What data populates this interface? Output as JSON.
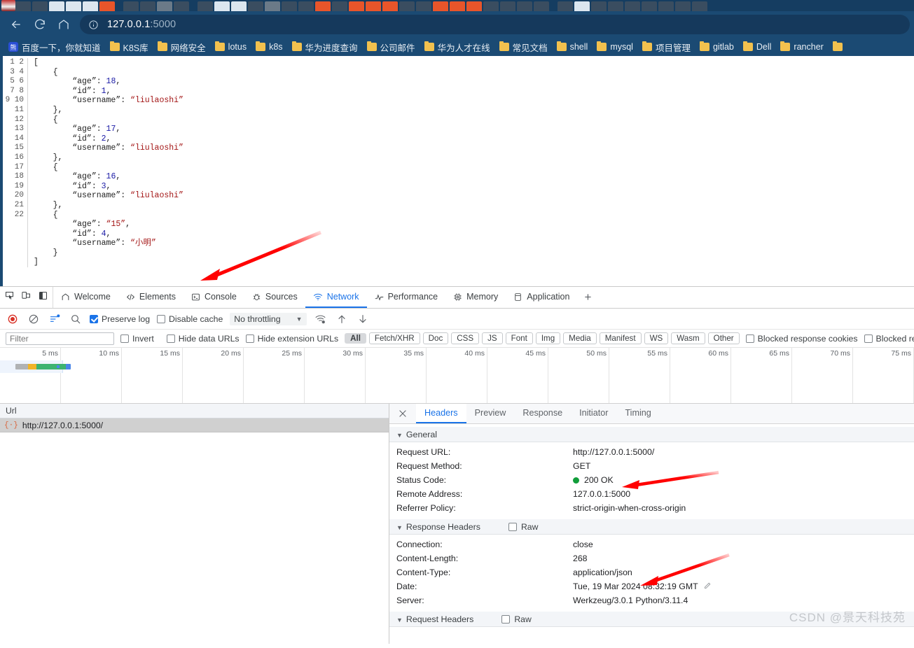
{
  "browser": {
    "nav": {
      "back": "back-arrow",
      "reload": "reload",
      "home": "home"
    },
    "omnibox": {
      "host": "127.0.0.1",
      "port": ":5000",
      "info_icon": "info-circle-icon"
    },
    "bookmarks": [
      {
        "label": "百度一下，你就知道",
        "icon": "baidu-icon"
      },
      {
        "label": "K8S库",
        "icon": "folder-icon"
      },
      {
        "label": "网络安全",
        "icon": "folder-icon"
      },
      {
        "label": "lotus",
        "icon": "folder-icon"
      },
      {
        "label": "k8s",
        "icon": "folder-icon"
      },
      {
        "label": "华为进度查询",
        "icon": "folder-icon"
      },
      {
        "label": "公司邮件",
        "icon": "folder-icon"
      },
      {
        "label": "华为人才在线",
        "icon": "folder-icon"
      },
      {
        "label": "常见文档",
        "icon": "folder-icon"
      },
      {
        "label": "shell",
        "icon": "folder-icon"
      },
      {
        "label": "mysql",
        "icon": "folder-icon"
      },
      {
        "label": "项目管理",
        "icon": "folder-icon"
      },
      {
        "label": "gitlab",
        "icon": "folder-icon"
      },
      {
        "label": "Dell",
        "icon": "folder-icon"
      },
      {
        "label": "rancher",
        "icon": "folder-icon"
      },
      {
        "label": "",
        "icon": "folder-icon"
      }
    ]
  },
  "page": {
    "json_lines": [
      "[",
      "    {",
      "        \"age\": 18,",
      "        \"id\": 1,",
      "        \"username\": \"liulaoshi\"",
      "    },",
      "    {",
      "        \"age\": 17,",
      "        \"id\": 2,",
      "        \"username\": \"liulaoshi\"",
      "    },",
      "    {",
      "        \"age\": 16,",
      "        \"id\": 3,",
      "        \"username\": \"liulaoshi\"",
      "    },",
      "    {",
      "        \"age\": \"15\",",
      "        \"id\": 4,",
      "        \"username\": \"小明\"",
      "    }",
      "]"
    ],
    "line_count": 22
  },
  "devtools": {
    "tool_icons": [
      "inspect-icon",
      "device-toolbar-icon",
      "dock-side-icon"
    ],
    "tabs": [
      {
        "label": "Welcome",
        "icon": "home-icon",
        "active": false
      },
      {
        "label": "Elements",
        "icon": "code-brackets-icon",
        "active": false
      },
      {
        "label": "Console",
        "icon": "console-icon",
        "active": false
      },
      {
        "label": "Sources",
        "icon": "bug-icon",
        "active": false
      },
      {
        "label": "Network",
        "icon": "network-wifi-icon",
        "active": true
      },
      {
        "label": "Performance",
        "icon": "performance-icon",
        "active": false
      },
      {
        "label": "Memory",
        "icon": "memory-chip-icon",
        "active": false
      },
      {
        "label": "Application",
        "icon": "application-icon",
        "active": false
      }
    ],
    "more_tabs_label": "+",
    "network_toolbar": {
      "record_icon": "record-stop-icon",
      "clear_icon": "clear-circle-icon",
      "filter_icon": "filter-settings-icon",
      "search_icon": "search-icon",
      "preserve_log": {
        "label": "Preserve log",
        "checked": true
      },
      "disable_cache": {
        "label": "Disable cache",
        "checked": false
      },
      "throttling": "No throttling",
      "wifi_icon": "network-conditions-icon",
      "import_icon": "import-har-icon",
      "export_icon": "export-har-icon"
    },
    "filter_row": {
      "placeholder": "Filter",
      "invert": {
        "label": "Invert",
        "checked": false
      },
      "hide_data_urls": {
        "label": "Hide data URLs",
        "checked": false
      },
      "hide_extension_urls": {
        "label": "Hide extension URLs",
        "checked": false
      },
      "types": [
        "All",
        "Fetch/XHR",
        "Doc",
        "CSS",
        "JS",
        "Font",
        "Img",
        "Media",
        "Manifest",
        "WS",
        "Wasm",
        "Other"
      ],
      "selected_type": "All",
      "blocked_response_cookies": {
        "label": "Blocked response cookies",
        "checked": false
      },
      "blocked_requests": {
        "label": "Blocked requests",
        "checked": false
      }
    },
    "timeline": {
      "ticks": [
        "5 ms",
        "10 ms",
        "15 ms",
        "20 ms",
        "25 ms",
        "30 ms",
        "35 ms",
        "40 ms",
        "45 ms",
        "50 ms",
        "55 ms",
        "60 ms",
        "65 ms",
        "70 ms",
        "75 ms"
      ],
      "waterfall_segments": [
        {
          "name": "queueing",
          "color": "#b0b2b4",
          "width": 18
        },
        {
          "name": "stalled",
          "color": "#f0b429",
          "width": 12
        },
        {
          "name": "waiting",
          "color": "#3cb371",
          "width": 42
        },
        {
          "name": "download",
          "color": "#4a86e8",
          "width": 7
        }
      ]
    },
    "request_list": {
      "column_header": "Url",
      "rows": [
        {
          "icon": "document-icon",
          "url": "http://127.0.0.1:5000/",
          "selected": true
        }
      ]
    },
    "detail": {
      "close_icon": "close-icon",
      "tabs": [
        "Headers",
        "Preview",
        "Response",
        "Initiator",
        "Timing"
      ],
      "active_tab": "Headers",
      "sections": [
        {
          "title": "General",
          "raw_toggle": null,
          "rows": [
            {
              "key": "Request URL:",
              "value": "http://127.0.0.1:5000/"
            },
            {
              "key": "Request Method:",
              "value": "GET"
            },
            {
              "key": "Status Code:",
              "value": "200 OK",
              "status_dot": "#119d3a"
            },
            {
              "key": "Remote Address:",
              "value": "127.0.0.1:5000"
            },
            {
              "key": "Referrer Policy:",
              "value": "strict-origin-when-cross-origin"
            }
          ]
        },
        {
          "title": "Response Headers",
          "raw_toggle": {
            "label": "Raw",
            "checked": false
          },
          "rows": [
            {
              "key": "Connection:",
              "value": "close"
            },
            {
              "key": "Content-Length:",
              "value": "268"
            },
            {
              "key": "Content-Type:",
              "value": "application/json"
            },
            {
              "key": "Date:",
              "value": "Tue, 19 Mar 2024 08:32:19 GMT",
              "edit_icon": "pencil-icon"
            },
            {
              "key": "Server:",
              "value": "Werkzeug/3.0.1 Python/3.11.4"
            }
          ]
        },
        {
          "title": "Request Headers",
          "raw_toggle": {
            "label": "Raw",
            "checked": false
          },
          "rows": []
        }
      ]
    }
  },
  "watermark": "CSDN @景天科技苑",
  "colors": {
    "chrome_blue": "#1b4a73",
    "accent": "#1a73e8",
    "status_ok": "#119d3a",
    "annotation_arrow": "#ff0000",
    "json_string": "#a31515",
    "json_number": "#1a1aa6"
  }
}
